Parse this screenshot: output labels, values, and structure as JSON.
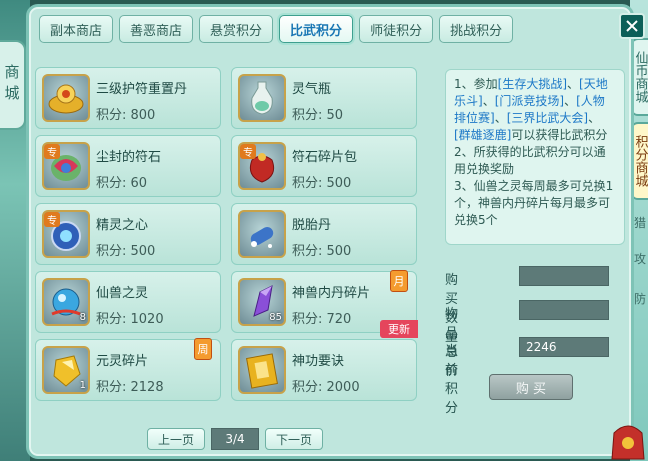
{
  "left_tab": "商城",
  "right_tabs": {
    "tab1": "仙币商城",
    "tab2": "积分商城"
  },
  "side_chars": [
    "猎",
    "攻",
    "防"
  ],
  "tabs": [
    "副本商店",
    "善恶商店",
    "悬赏积分",
    "比武积分",
    "师徒积分",
    "挑战积分"
  ],
  "active_tab_index": 3,
  "items": [
    {
      "name": "三级护符重置丹",
      "price_label": "积分: 800",
      "icon": "gold-bowl-icon"
    },
    {
      "name": "灵气瓶",
      "price_label": "积分: 50",
      "icon": "spirit-vase-icon"
    },
    {
      "name": "尘封的符石",
      "price_label": "积分: 60",
      "icon": "rune-stone-icon",
      "special": "专"
    },
    {
      "name": "符石碎片包",
      "price_label": "积分: 500",
      "icon": "red-pouch-icon",
      "special": "专"
    },
    {
      "name": "精灵之心",
      "price_label": "积分: 500",
      "icon": "spirit-heart-icon",
      "special": "专"
    },
    {
      "name": "脱胎丹",
      "price_label": "积分: 500",
      "icon": "pill-icon"
    },
    {
      "name": "仙兽之灵",
      "price_label": "积分: 1020",
      "icon": "blue-orb-icon",
      "count": "8"
    },
    {
      "name": "神兽内丹碎片",
      "price_label": "积分: 720",
      "icon": "purple-crystal-icon",
      "count": "85",
      "tag": "月",
      "new_tag": "更新"
    },
    {
      "name": "元灵碎片",
      "price_label": "积分: 2128",
      "icon": "gold-shard-icon",
      "count": "1",
      "tag": "周"
    },
    {
      "name": "神功要诀",
      "price_label": "积分: 2000",
      "icon": "gold-book-icon"
    }
  ],
  "description": {
    "line1_prefix": "1、参加",
    "links": [
      "[生存大挑战]",
      "[天地乐斗]",
      "[门派竞技场]",
      "[人物排位赛]",
      "[三界比武大会]",
      "[群雄逐鹿]"
    ],
    "line1_suffix": "可以获得比武积分",
    "line2": "2、所获得的比武积分可以通用兑换奖励",
    "line3": "3、仙兽之灵每周最多可兑换1个，神兽内丹碎片每月最多可兑换5个"
  },
  "purchase": {
    "qty_label": "购买数量",
    "qty_value": "",
    "total_label": "物品总价",
    "total_value": "",
    "points_label": "当前积分",
    "points_value": "2246",
    "buy_label": "购 买"
  },
  "pager": {
    "prev": "上一页",
    "page": "3/4",
    "next": "下一页"
  },
  "colors": {
    "panel": "#bfe6dd",
    "link": "#1c78c7",
    "accent": "#1a77b4"
  }
}
